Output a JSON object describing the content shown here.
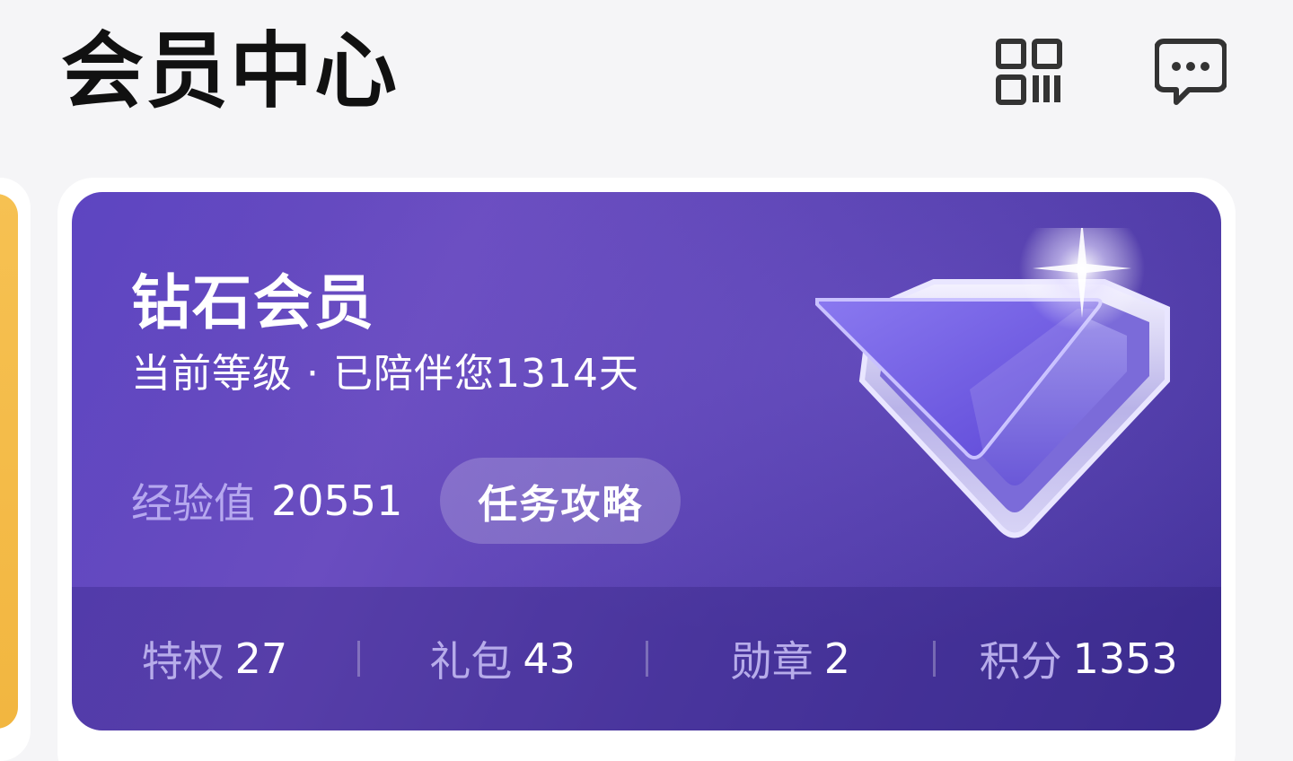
{
  "header": {
    "title": "会员中心",
    "qr_icon": "qr-code-icon",
    "message_icon": "chat-bubble-icon"
  },
  "card": {
    "level_name": "钻石会员",
    "subtitle": "当前等级 · 已陪伴您1314天",
    "exp_label": "经验值",
    "exp_value": "20551",
    "task_button": "任务攻略",
    "badge_icon": "diamond-level-badge-icon",
    "stats": [
      {
        "label": "特权",
        "value": "27"
      },
      {
        "label": "礼包",
        "value": "43"
      },
      {
        "label": "勋章",
        "value": "2"
      },
      {
        "label": "积分",
        "value": "1353"
      }
    ]
  },
  "colors": {
    "card_primary": "#5d45c1",
    "card_dark": "#43329a",
    "peek_card": "#f6c152",
    "muted_label": "#b7acea"
  }
}
